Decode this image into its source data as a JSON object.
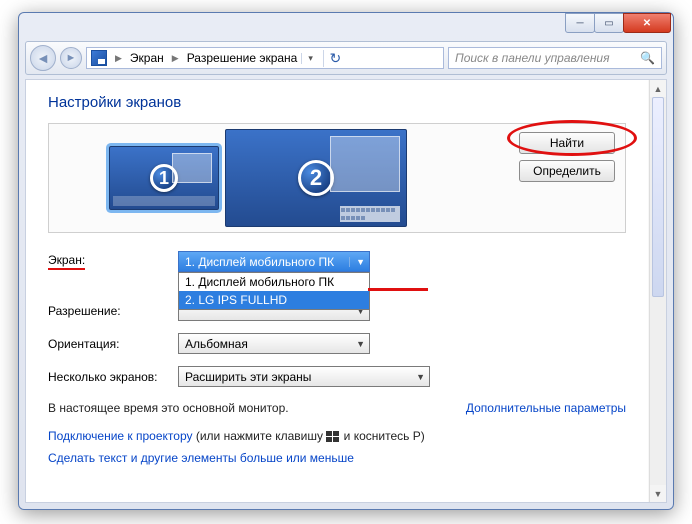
{
  "breadcrumb": {
    "item1": "Экран",
    "item2": "Разрешение экрана"
  },
  "search": {
    "placeholder": "Поиск в панели управления"
  },
  "heading": "Настройки экранов",
  "monitors": {
    "find": "Найти",
    "identify": "Определить",
    "num1": "1",
    "num2": "2"
  },
  "form": {
    "display_label": "Экран:",
    "display_value": "1. Дисплей мобильного ПК",
    "display_options": {
      "opt1": "1. Дисплей мобильного ПК",
      "opt2": "2. LG IPS FULLHD"
    },
    "resolution_label": "Разрешение:",
    "orientation_label": "Ориентация:",
    "orientation_value": "Альбомная",
    "multi_label": "Несколько экранов:",
    "multi_value": "Расширить эти экраны"
  },
  "note_primary": "В настоящее время это основной монитор.",
  "advanced": "Дополнительные параметры",
  "projector": {
    "link": "Подключение к проектору",
    "hint_pre": " (или нажмите клавишу ",
    "hint_post": " и коснитесь P)"
  },
  "text_size": "Сделать текст и другие элементы больше или меньше"
}
